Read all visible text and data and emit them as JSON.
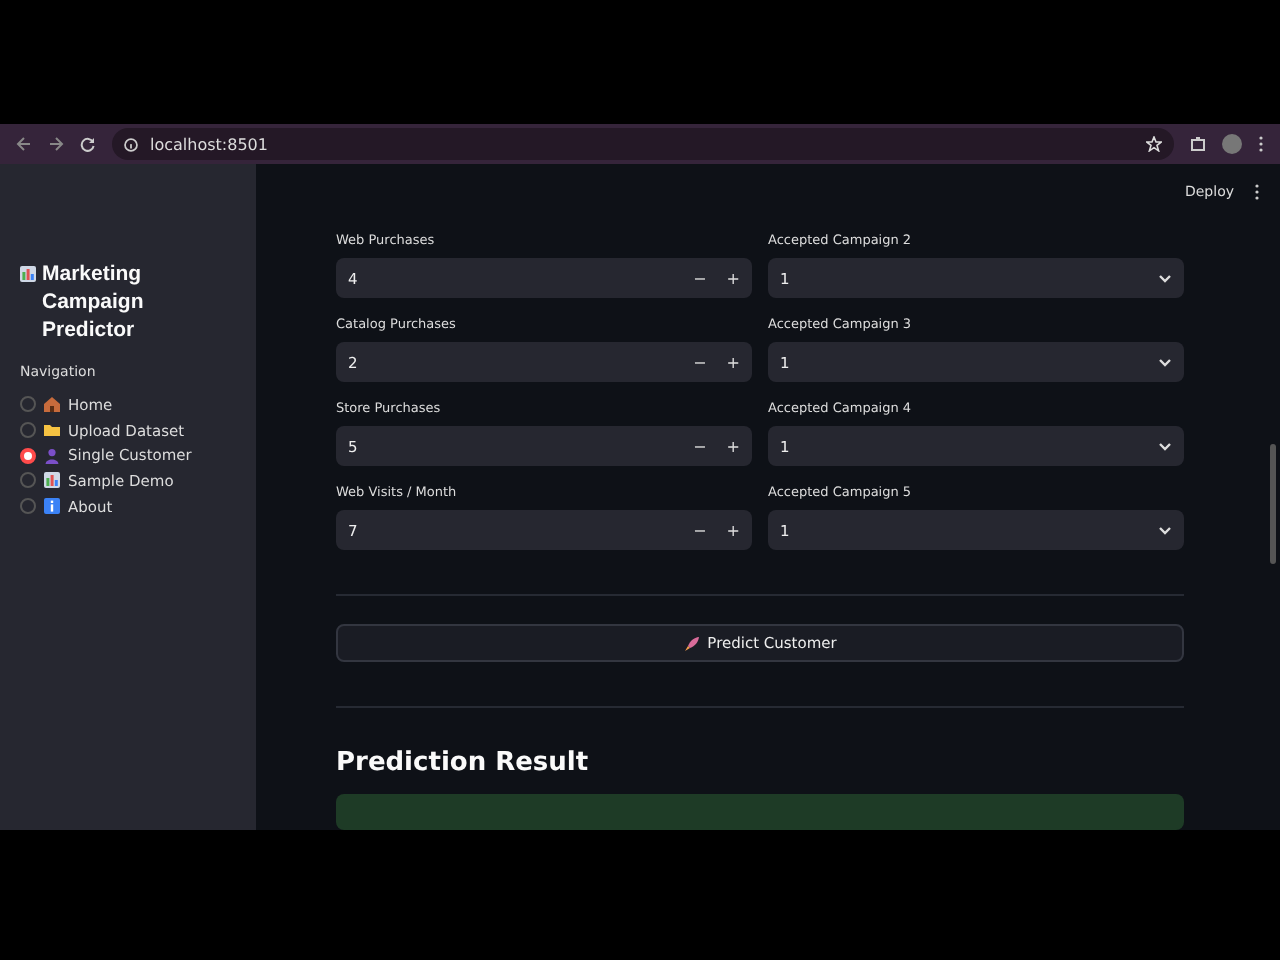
{
  "browser": {
    "url": "localhost:8501"
  },
  "header": {
    "deploy": "Deploy"
  },
  "sidebar": {
    "title": "Marketing Campaign Predictor",
    "nav_label": "Navigation",
    "items": [
      {
        "label": "Home",
        "kind": "house",
        "selected": false
      },
      {
        "label": "Upload Dataset",
        "kind": "folder",
        "selected": false
      },
      {
        "label": "Single Customer",
        "kind": "person",
        "selected": true
      },
      {
        "label": "Sample Demo",
        "kind": "chart",
        "selected": false
      },
      {
        "label": "About",
        "kind": "info",
        "selected": false
      }
    ]
  },
  "form": {
    "rows": [
      {
        "left": {
          "label": "Web Purchases",
          "value": "4"
        },
        "right": {
          "label": "Accepted Campaign 2",
          "value": "1"
        }
      },
      {
        "left": {
          "label": "Catalog Purchases",
          "value": "2"
        },
        "right": {
          "label": "Accepted Campaign 3",
          "value": "1"
        }
      },
      {
        "left": {
          "label": "Store Purchases",
          "value": "5"
        },
        "right": {
          "label": "Accepted Campaign 4",
          "value": "1"
        }
      },
      {
        "left": {
          "label": "Web Visits / Month",
          "value": "7"
        },
        "right": {
          "label": "Accepted Campaign 5",
          "value": "1"
        }
      }
    ],
    "minus": "−",
    "plus": "+"
  },
  "predict_button": "Predict Customer",
  "result": {
    "heading": "Prediction Result"
  }
}
